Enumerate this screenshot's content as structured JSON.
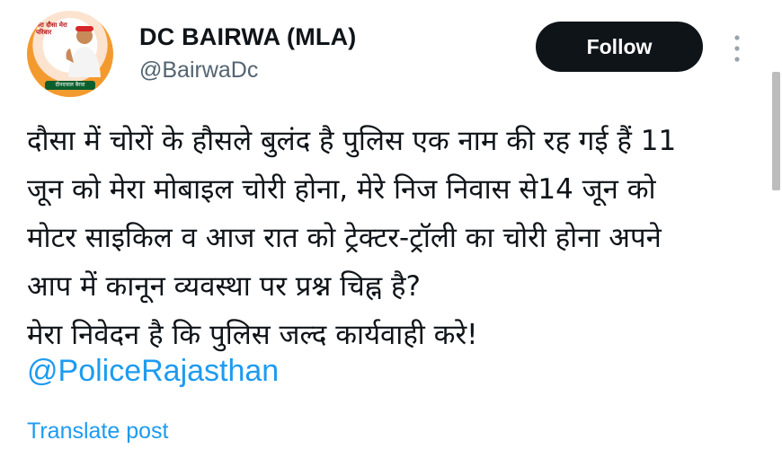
{
  "author": {
    "display_name": "DC BAIRWA (MLA)",
    "handle": "@BairwaDc",
    "avatar_caption_top": "मेरा दौसा मेरा परिवार",
    "avatar_caption_bottom": "दीनदयाल बैरवा"
  },
  "actions": {
    "follow_label": "Follow",
    "more_icon": "more-vertical-icon"
  },
  "tweet": {
    "lines": [
      "दौसा में चोरों के हौसले बुलंद है पुलिस एक नाम की रह गई हैं 11",
      "जून को मेरा मोबाइल चोरी होना, मेरे निज निवास से14 जून को",
      "मोटर साइकिल व आज रात को ट्रेक्टर-ट्रॉली का चोरी होना अपने",
      "आप में कानून व्यवस्था पर प्रश्न चिह्न है?",
      "मेरा निवेदन है कि पुलिस जल्द कार्यवाही करे!"
    ],
    "mention": "@PoliceRajasthan",
    "translate_label": "Translate post"
  },
  "colors": {
    "link": "#1d9bf0",
    "text": "#0f1419",
    "secondary": "#536471",
    "button_bg": "#0f1419"
  }
}
